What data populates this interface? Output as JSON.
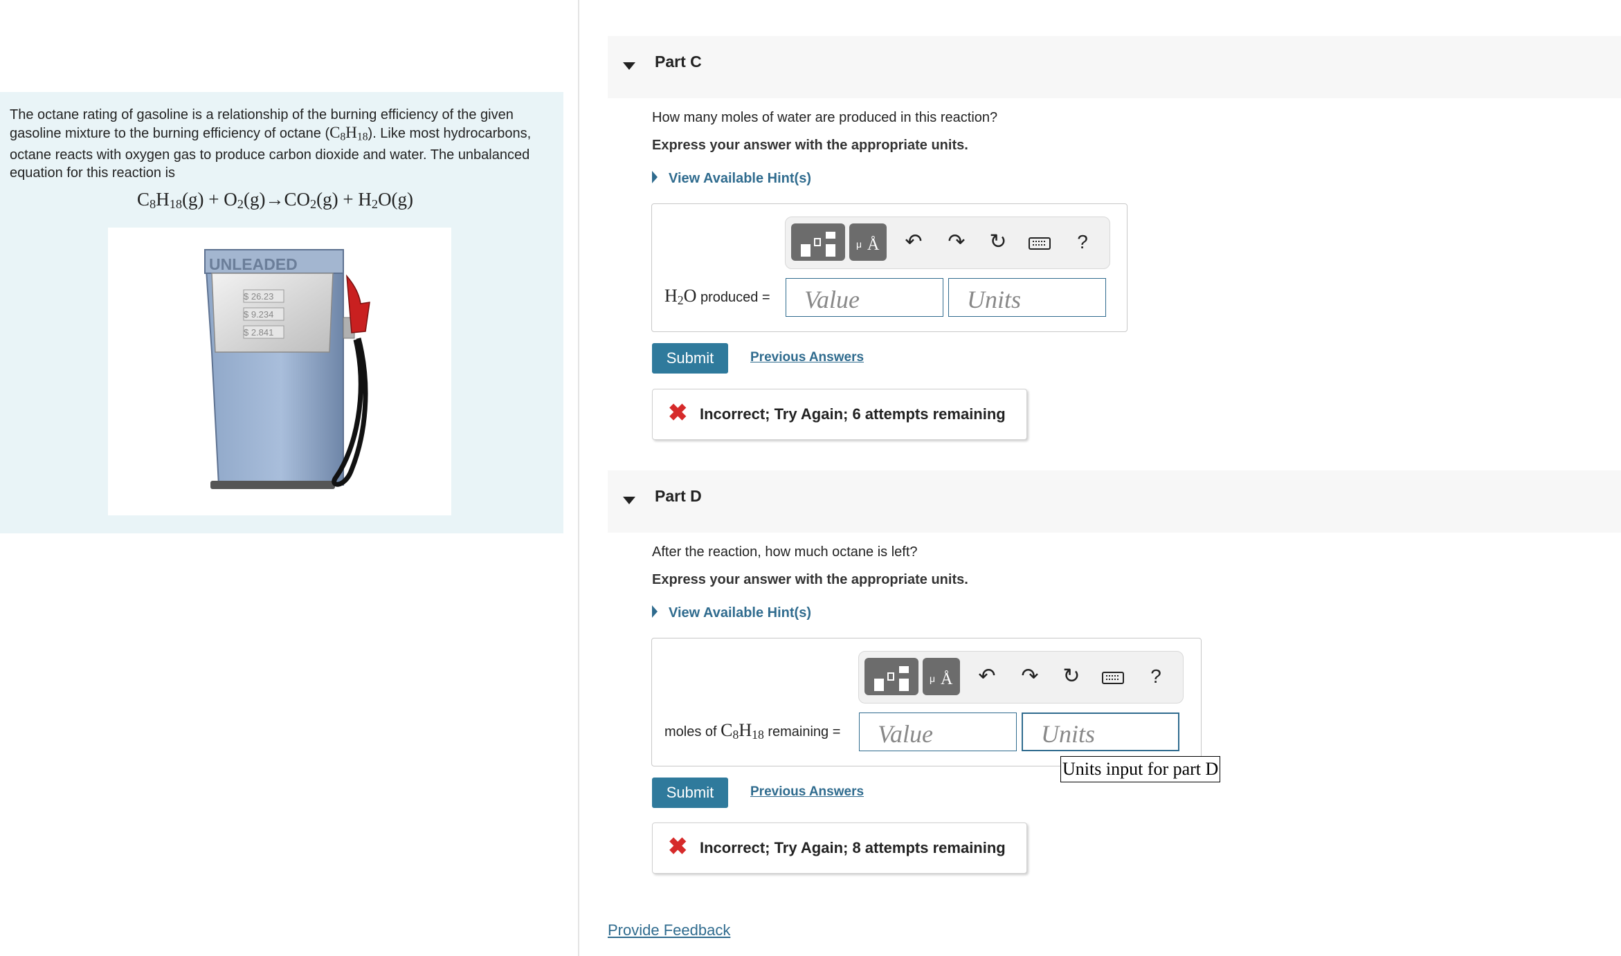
{
  "problem": {
    "intro": "The octane rating of gasoline is a relationship of the burning efficiency of the given gasoline mixture to the burning efficiency of octane (",
    "octane_c": "C",
    "octane_c_sub": "8",
    "octane_h": "H",
    "octane_h_sub": "18",
    "intro_end": "). Like most hydrocarbons, octane reacts with oxygen gas to produce carbon dioxide and water. The unbalanced equation for this reaction is",
    "eq": {
      "c": "C",
      "c_sub": "8",
      "h": "H",
      "h_sub": "18",
      "t1": "(g) + O",
      "o_sub": "2",
      "t2": "(g)→CO",
      "co_sub": "2",
      "t3": "(g) + H",
      "h2_sub": "2",
      "t4": "O(g)"
    },
    "image": {
      "sign": "UNLEADED",
      "price1": "$ 26.23",
      "price2": "$ 9.234",
      "price3": "$ 2.841"
    }
  },
  "part_c": {
    "title": "Part C",
    "question": "How many moles of water are produced in this reaction?",
    "instruction": "Express your answer with the appropriate units.",
    "hint": "View Available Hint(s)",
    "label_h": "H",
    "label_h_sub": "2",
    "label_o": "O",
    "label_rest": " produced =",
    "value_placeholder": "Value",
    "units_placeholder": "Units",
    "submit": "Submit",
    "previous": "Previous Answers",
    "feedback": "Incorrect; Try Again; 6 attempts remaining"
  },
  "part_d": {
    "title": "Part D",
    "question": "After the reaction, how much octane is left?",
    "instruction": "Express your answer with the appropriate units.",
    "hint": "View Available Hint(s)",
    "label_pre": "moles of ",
    "label_c": "C",
    "label_c_sub": "8",
    "label_h": "H",
    "label_h_sub": "18",
    "label_post": " remaining =",
    "value_placeholder": "Value",
    "units_placeholder": "Units",
    "submit": "Submit",
    "previous": "Previous Answers",
    "feedback": "Incorrect; Try Again; 8 attempts remaining",
    "tooltip": "Units input for part D"
  },
  "toolbar": {
    "units_symbol": "Å",
    "units_mu": "μ",
    "undo": "↶",
    "redo": "↷",
    "reset": "↻",
    "help": "?"
  },
  "footer": {
    "provide_feedback": "Provide Feedback"
  }
}
